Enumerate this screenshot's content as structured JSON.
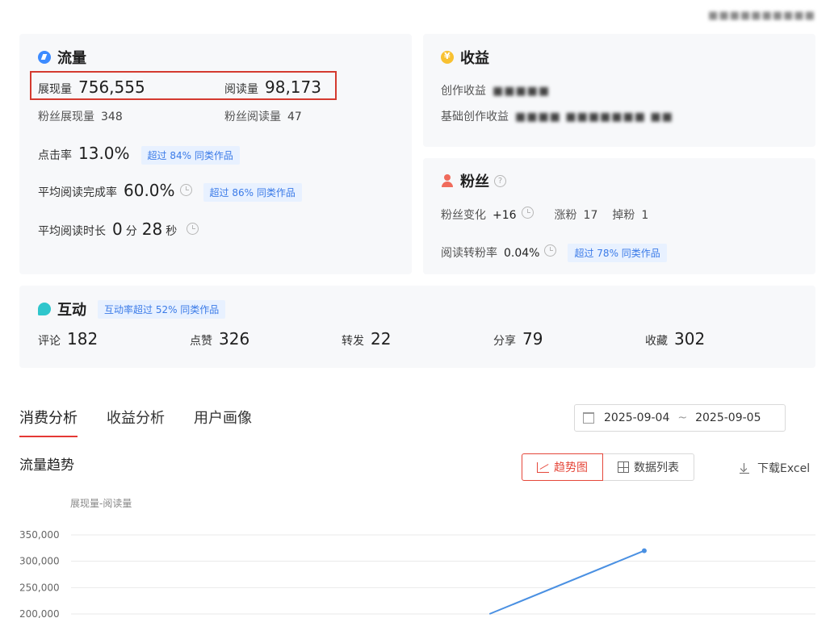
{
  "header": {
    "blurred_account": "■■■■■■■■■■"
  },
  "traffic": {
    "title": "流量",
    "impressions_label": "展现量",
    "impressions_value": "756,555",
    "reads_label": "阅读量",
    "reads_value": "98,173",
    "fan_impressions_label": "粉丝展现量",
    "fan_impressions_value": "348",
    "fan_reads_label": "粉丝阅读量",
    "fan_reads_value": "47",
    "ctr_label": "点击率",
    "ctr_value": "13.0%",
    "ctr_badge": "超过 84% 同类作品",
    "completion_label": "平均阅读完成率",
    "completion_value": "60.0%",
    "completion_badge": "超过 86% 同类作品",
    "duration_label": "平均阅读时长",
    "duration_min": "0",
    "duration_min_unit": "分",
    "duration_sec": "28",
    "duration_sec_unit": "秒"
  },
  "income": {
    "title": "收益",
    "creation_label": "创作收益",
    "creation_value": "■■■■■",
    "basic_label": "基础创作收益",
    "basic_value": "■■■■ ■■■■■■■ ■■"
  },
  "fans": {
    "title": "粉丝",
    "change_label": "粉丝变化",
    "change_value": "+16",
    "gain_label": "涨粉",
    "gain_value": "17",
    "loss_label": "掉粉",
    "loss_value": "1",
    "conversion_label": "阅读转粉率",
    "conversion_value": "0.04%",
    "conversion_badge": "超过 78% 同类作品"
  },
  "interaction": {
    "title": "互动",
    "badge": "互动率超过 52% 同类作品",
    "items": [
      {
        "label": "评论",
        "value": "182"
      },
      {
        "label": "点赞",
        "value": "326"
      },
      {
        "label": "转发",
        "value": "22"
      },
      {
        "label": "分享",
        "value": "79"
      },
      {
        "label": "收藏",
        "value": "302"
      }
    ]
  },
  "tabs": [
    {
      "label": "消费分析"
    },
    {
      "label": "收益分析"
    },
    {
      "label": "用户画像"
    }
  ],
  "date_range": {
    "start": "2025-09-04",
    "separator": "~",
    "end": "2025-09-05"
  },
  "trend": {
    "title": "流量趋势",
    "trend_button": "趋势图",
    "list_button": "数据列表",
    "download": "下载Excel"
  },
  "colors": {
    "accent": "#e5473a",
    "line": "#4a90e2",
    "badge_bg": "#e8f1ff",
    "badge_text": "#3b7be8"
  },
  "chart_data": {
    "type": "line",
    "legend_text": "展现量-阅读量",
    "y_ticks": [
      "350,000",
      "300,000",
      "250,000",
      "200,000"
    ],
    "ylim": [
      200000,
      350000
    ],
    "series": [
      {
        "points": [
          {
            "x": 0.73,
            "y": 200000
          },
          {
            "x": 1.0,
            "y": 320000
          }
        ]
      }
    ]
  }
}
